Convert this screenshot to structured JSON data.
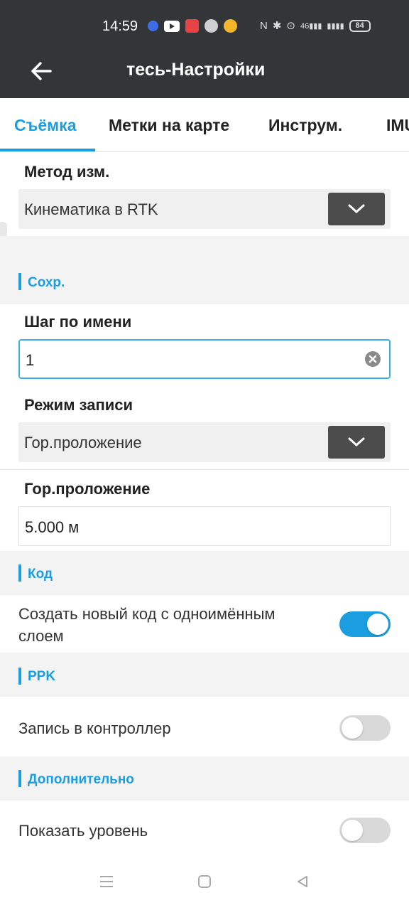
{
  "status": {
    "time": "14:59",
    "net_label": "46",
    "battery": "84"
  },
  "appbar": {
    "title": "тесь-Настройки",
    "back_icon": "arrow-left-icon"
  },
  "tabs": [
    {
      "label": "Съёмка",
      "active": true
    },
    {
      "label": "Метки на карте",
      "active": false
    },
    {
      "label": "Инструм.",
      "active": false
    },
    {
      "label": "IMU",
      "active": false
    }
  ],
  "method": {
    "label": "Метод изм.",
    "value": "Кинематика в RTK"
  },
  "save_section": {
    "title": "Сохр.",
    "name_step_label": "Шаг по имени",
    "name_step_value": "1",
    "record_mode_label": "Режим записи",
    "record_mode_value": "Гор.проложение",
    "distance_label": "Гор.проложение",
    "distance_value": "5.000 м"
  },
  "code_section": {
    "title": "Код",
    "create_code_label": "Создать новый код с одноимённым слоем",
    "create_code_line1": "Создать новый код с одноимённым",
    "create_code_line2": "слоем",
    "create_code_on": true
  },
  "ppk_section": {
    "title": "PPK",
    "record_controller_label": "Запись в контроллер",
    "record_controller_on": false
  },
  "extra_section": {
    "title": "Дополнительно",
    "show_level_label": "Показать уровень",
    "show_level_on": false
  },
  "colors": {
    "accent": "#1a9ee0",
    "appbar": "#333538",
    "section_bg": "#f3f3f3"
  }
}
